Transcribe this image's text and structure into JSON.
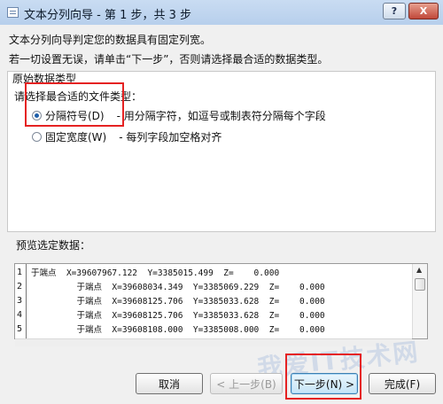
{
  "window": {
    "title": "文本分列向导 - 第 1 步，共 3 步",
    "help_label": "?",
    "close_label": "X"
  },
  "intro": {
    "line1": "文本分列向导判定您的数据具有固定列宽。",
    "line2": "若一切设置无误，请单击“下一步”，否则请选择最合适的数据类型。"
  },
  "original_data_type": {
    "group_title": "原始数据类型",
    "prompt": "请选择最合适的文件类型：",
    "options": [
      {
        "label": "分隔符号(D)",
        "description": "- 用分隔字符，如逗号或制表符分隔每个字段",
        "selected": true
      },
      {
        "label": "固定宽度(W)",
        "description": "- 每列字段加空格对齐",
        "selected": false
      }
    ]
  },
  "preview": {
    "label": "预览选定数据：",
    "row_numbers": [
      "1",
      "2",
      "3",
      "4",
      "5"
    ],
    "lines": [
      "于端点  X=39607967.122  Y=3385015.499  Z=    0.000",
      "         于端点  X=39608034.349  Y=3385069.229  Z=    0.000",
      "         于端点  X=39608125.706  Y=3385033.628  Z=    0.000",
      "         于端点  X=39608125.706  Y=3385033.628  Z=    0.000",
      "         于端点  X=39608108.000  Y=3385008.000  Z=    0.000"
    ]
  },
  "buttons": {
    "cancel": "取消",
    "back": "< 上一步(B)",
    "next": "下一步(N) >",
    "finish": "完成(F)"
  },
  "watermark": "我爱IT技术网"
}
